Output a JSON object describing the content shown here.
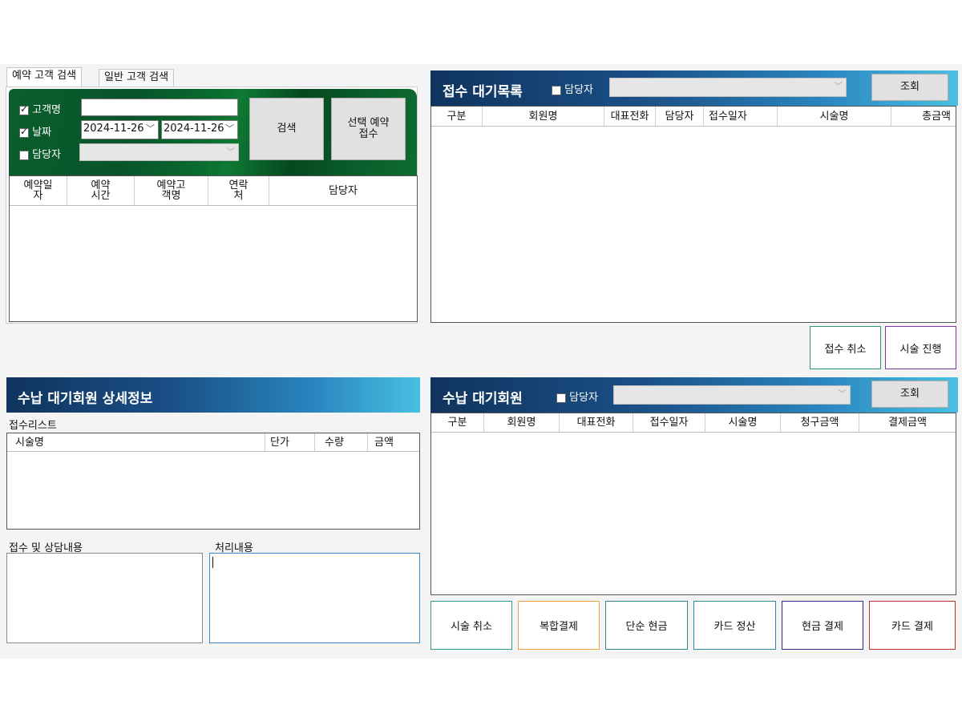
{
  "tabs": [
    "예약 고객 검색",
    "일반 고객 검색"
  ],
  "reservation_search": {
    "customer_name_label": "고객명",
    "date_label": "날짜",
    "manager_label": "담당자",
    "customer_name_value": "",
    "date_from": "2024-11-26",
    "date_to": "2024-11-26",
    "search_button": "검색",
    "select_reservation_button": "선택 예약 접수",
    "columns": [
      "예약일자",
      "예약시간",
      "예약고객명",
      "연락처",
      "담당자"
    ]
  },
  "reception_waitlist": {
    "title": "접수 대기목록",
    "manager_filter_label": "담당자",
    "query_button": "조회",
    "columns": [
      "구분",
      "회원명",
      "대표전화",
      "담당자",
      "접수일자",
      "시술명",
      "총금액"
    ],
    "cancel_reception_button": "접수 취소",
    "proceed_button": "시술 진행"
  },
  "payment_detail": {
    "title": "수납 대기회원 상세정보",
    "reception_list_label": "접수리스트",
    "columns": [
      "시술명",
      "단가",
      "수량",
      "금액"
    ],
    "consult_label": "접수 및 상담내용",
    "process_label": "처리내용"
  },
  "payment_waitlist": {
    "title": "수납 대기회원",
    "manager_filter_label": "담당자",
    "query_button": "조회",
    "columns": [
      "구분",
      "회원명",
      "대표전화",
      "접수일자",
      "시술명",
      "청구금액",
      "결제금액"
    ],
    "buttons": [
      "시술 취소",
      "복합결제",
      "단순 현금",
      "카드 정산",
      "현금 결제",
      "카드 결제"
    ],
    "button_colors": [
      "#2a9a8a",
      "#f0a040",
      "#2a8a8a",
      "#2a8aa0",
      "#2a2a8a",
      "#c03030"
    ]
  }
}
